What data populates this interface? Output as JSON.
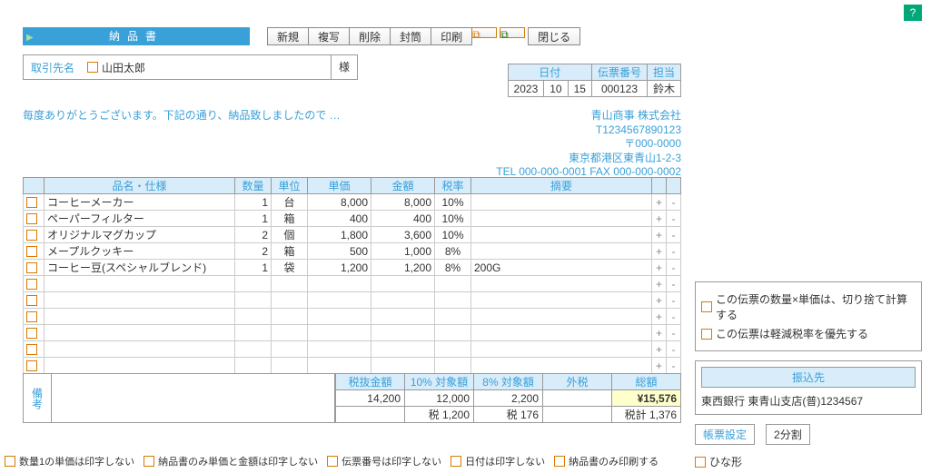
{
  "doc_title": "納品書",
  "toolbar": {
    "new": "新規",
    "copy": "複写",
    "delete": "削除",
    "envelope": "封筒",
    "print": "印刷",
    "close": "閉じる"
  },
  "client": {
    "label": "取引先名",
    "name": "山田太郎",
    "honor": "様"
  },
  "date": {
    "hdr1": "日付",
    "hdr2": "伝票番号",
    "hdr3": "担当",
    "y": "2023",
    "m": "10",
    "d": "15",
    "num": "000123",
    "staff": "鈴木"
  },
  "greeting": "毎度ありがとうございます。下記の通り、納品致しましたので …",
  "company": {
    "name": "青山商事 株式会社",
    "reg": "T1234567890123",
    "zip": "〒000-0000",
    "addr": "東京都港区東青山1-2-3",
    "tel": "TEL 000-000-0001  FAX 000-000-0002"
  },
  "cols": {
    "name": "品名・仕様",
    "qty": "数量",
    "unit": "単位",
    "price": "単価",
    "amount": "金額",
    "tax": "税率",
    "note": "摘要"
  },
  "rows": [
    {
      "name": "コーヒーメーカー",
      "qty": "1",
      "unit": "台",
      "price": "8,000",
      "amount": "8,000",
      "tax": "10%",
      "note": ""
    },
    {
      "name": "ペーパーフィルター",
      "qty": "1",
      "unit": "箱",
      "price": "400",
      "amount": "400",
      "tax": "10%",
      "note": ""
    },
    {
      "name": "オリジナルマグカップ",
      "qty": "2",
      "unit": "個",
      "price": "1,800",
      "amount": "3,600",
      "tax": "10%",
      "note": ""
    },
    {
      "name": "メープルクッキー",
      "qty": "2",
      "unit": "箱",
      "price": "500",
      "amount": "1,000",
      "tax": "8%",
      "note": ""
    },
    {
      "name": "コーヒー豆(スペシャルブレンド)",
      "qty": "1",
      "unit": "袋",
      "price": "1,200",
      "amount": "1,200",
      "tax": "8%",
      "note": "200G"
    }
  ],
  "blank_rows": 6,
  "bikou": "備考",
  "totals": {
    "h1": "税抜金額",
    "h2": "10% 対象額",
    "h3": "8% 対象額",
    "h4": "外税",
    "h5": "総額",
    "v1": "14,200",
    "v2": "12,000",
    "v3": "2,200",
    "v5": "¥15,576",
    "t2": "税 1,200",
    "t3": "税 176",
    "t5": "税計 1,376"
  },
  "side": {
    "opt1": "この伝票の数量×単価は、切り捨て計算する",
    "opt2": "この伝票は軽減税率を優先する",
    "bank_hdr": "振込先",
    "bank": "東西銀行  東青山支店(普)1234567",
    "btn1": "帳票設定",
    "btn2": "2分割",
    "hinagata": "ひな形"
  },
  "footer": {
    "f1": "数量1の単価は印字しない",
    "f2": "納品書のみ単価と金額は印字しない",
    "f3": "伝票番号は印字しない",
    "f4": "日付は印字しない",
    "f5": "納品書のみ印刷する"
  },
  "help": "?"
}
